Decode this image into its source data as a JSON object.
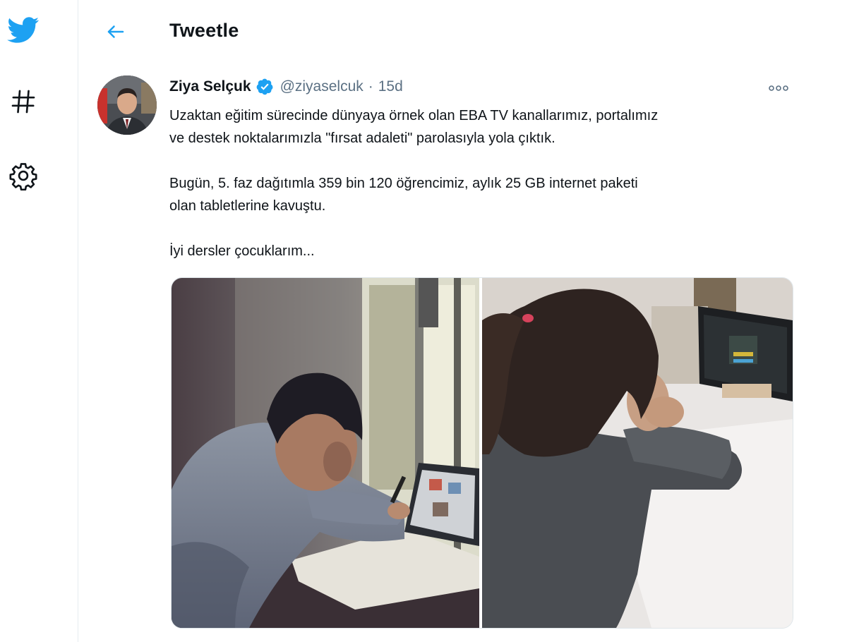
{
  "nav": {
    "items": [
      {
        "icon": "twitter-bird-icon",
        "color": "#1da1f2"
      },
      {
        "icon": "hashtag-icon"
      },
      {
        "icon": "gear-icon"
      }
    ]
  },
  "header": {
    "title": "Tweetle",
    "back_icon": "arrow-left-icon",
    "accent": "#1da1f2"
  },
  "tweet": {
    "author": {
      "display_name": "Ziya Selçuk",
      "verified": true,
      "handle": "@ziyaselcuk"
    },
    "separator": "·",
    "timestamp": "15d",
    "more_icon": "more-horizontal-icon",
    "text": {
      "line1": "Uzaktan eğitim sürecinde dünyaya örnek olan EBA TV kanallarımız, portalımız",
      "line2": "ve destek noktalarımızla \"fırsat adaleti\" parolasıyla yola çıktık.",
      "line3": "Bugün, 5. faz dağıtımla 359 bin 120 öğrencimiz, aylık 25 GB internet paketi",
      "line4": "olan tabletlerine kavuştu.",
      "line5": "İyi dersler çocuklarım..."
    },
    "media": [
      {
        "kind": "photo"
      },
      {
        "kind": "photo"
      }
    ]
  },
  "colors": {
    "text": "#0f1419",
    "secondary": "#5b7083",
    "border": "#e6ecf0",
    "verified_badge": "#1da1f2"
  }
}
